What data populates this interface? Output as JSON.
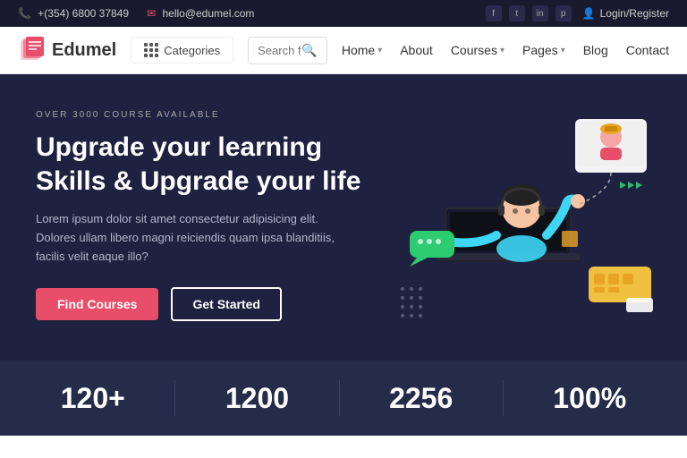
{
  "topbar": {
    "phone": "+(354) 6800 37849",
    "email": "hello@edumel.com",
    "login_label": "Login/Register",
    "social": [
      "f",
      "t",
      "in",
      "p"
    ]
  },
  "header": {
    "logo_text": "Edumel",
    "categories_label": "Categories",
    "search_placeholder": "Search for anything",
    "nav_items": [
      {
        "label": "Home",
        "has_dropdown": true
      },
      {
        "label": "About",
        "has_dropdown": false
      },
      {
        "label": "Courses",
        "has_dropdown": true
      },
      {
        "label": "Pages",
        "has_dropdown": true
      },
      {
        "label": "Blog",
        "has_dropdown": false
      },
      {
        "label": "Contact",
        "has_dropdown": false
      }
    ]
  },
  "hero": {
    "tag": "Over 3000 Course Available",
    "title_line1": "Upgrade your learning",
    "title_line2": "Skills & Upgrade your life",
    "description": "Lorem ipsum dolor sit amet consectetur adipisicing elit. Dolores ullam libero magni reiciendis quam ipsa blanditiis, facilis velit eaque illo?",
    "btn_primary": "Find Courses",
    "btn_outline": "Get Started"
  },
  "stats": [
    {
      "number": "120+",
      "label": ""
    },
    {
      "number": "1200",
      "label": ""
    },
    {
      "number": "2256",
      "label": ""
    },
    {
      "number": "100%",
      "label": ""
    }
  ],
  "colors": {
    "accent": "#e84d6a",
    "hero_bg": "#1e2140",
    "stats_bg": "#252c4a",
    "topbar_bg": "#1a1a2e"
  }
}
